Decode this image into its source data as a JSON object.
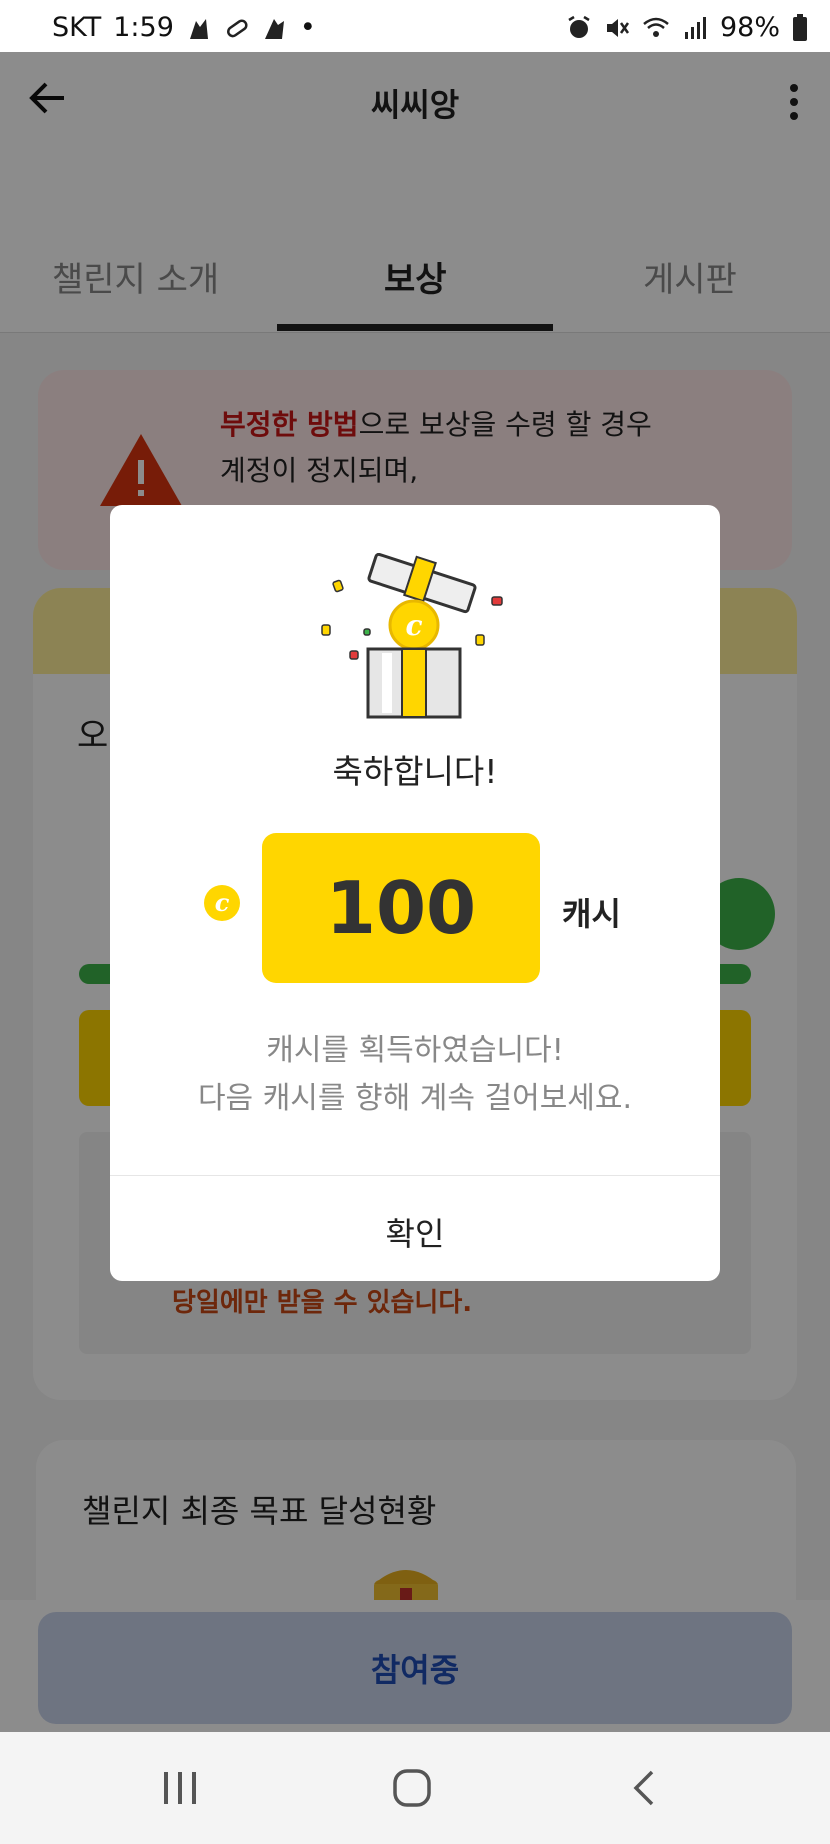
{
  "status_bar": {
    "carrier": "SKT",
    "time": "1:59",
    "dot": "•",
    "battery": "98%"
  },
  "header": {
    "back_icon": "arrow-left-icon",
    "title": "씨씨앙",
    "more_icon": "more-vert-icon"
  },
  "tabs": [
    {
      "label": "챌린지 소개",
      "active": false
    },
    {
      "label": "보상",
      "active": true
    },
    {
      "label": "게시판",
      "active": false
    }
  ],
  "warning": {
    "red_text": "부정한 방법",
    "line1_rest": "으로 보상을 수령 할 경우",
    "line2": "계정이 정지되며,"
  },
  "reward_card": {
    "partial_heading": "오",
    "note": "당일에만 받을 수 있습니다."
  },
  "goal_card": {
    "title": "챌린지 최종 목표 달성현황"
  },
  "join_button": {
    "label": "참여중"
  },
  "dialog": {
    "title": "축하합니다!",
    "coin_symbol": "c",
    "amount": "100",
    "unit": "캐시",
    "message_line1": "캐시를 획득하였습니다!",
    "message_line2": "다음 캐시를 향해 계속 걸어보세요.",
    "confirm_label": "확인"
  },
  "nav_bar": {
    "recents_icon": "recents-icon",
    "home_icon": "home-icon",
    "back_icon": "back-chevron-icon"
  },
  "colors": {
    "accent_yellow": "#FFD600",
    "warning_red": "#C81616",
    "join_blue": "#1F4DB4",
    "progress_green": "#3CB34A"
  }
}
